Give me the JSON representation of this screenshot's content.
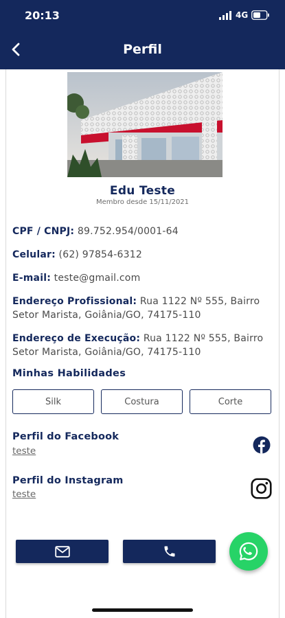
{
  "status_bar": {
    "time": "20:13",
    "network": "4G"
  },
  "nav": {
    "title": "Perfil",
    "back_icon": "chevron-left-icon"
  },
  "profile": {
    "name": "Edu Teste",
    "member_since": "Membro desde 15/11/2021"
  },
  "fields": [
    {
      "label": "CPF / CNPJ:",
      "value": "89.752.954/0001-64"
    },
    {
      "label": "Celular:",
      "value": "(62) 97854-6312"
    },
    {
      "label": "E-mail:",
      "value": "teste@gmail.com"
    },
    {
      "label": "Endereço Profissional:",
      "value": "Rua 1122 Nº 555, Bairro Setor Marista, Goiânia/GO, 74175-110"
    },
    {
      "label": "Endereço de Execução:",
      "value": "Rua 1122 Nº 555, Bairro Setor Marista, Goiânia/GO, 74175-110"
    }
  ],
  "skills": {
    "title": "Minhas Habilidades",
    "items": [
      "Silk",
      "Costura",
      "Corte"
    ]
  },
  "social": {
    "facebook": {
      "label": "Perfil do Facebook",
      "value": "teste",
      "icon": "facebook-icon"
    },
    "instagram": {
      "label": "Perfil do Instagram",
      "value": "teste",
      "icon": "instagram-icon"
    }
  },
  "actions": {
    "email_icon": "mail-icon",
    "phone_icon": "phone-icon",
    "whatsapp_icon": "whatsapp-icon"
  },
  "colors": {
    "primary": "#14285c",
    "whatsapp": "#27d367",
    "cover_red": "#c8102e"
  }
}
